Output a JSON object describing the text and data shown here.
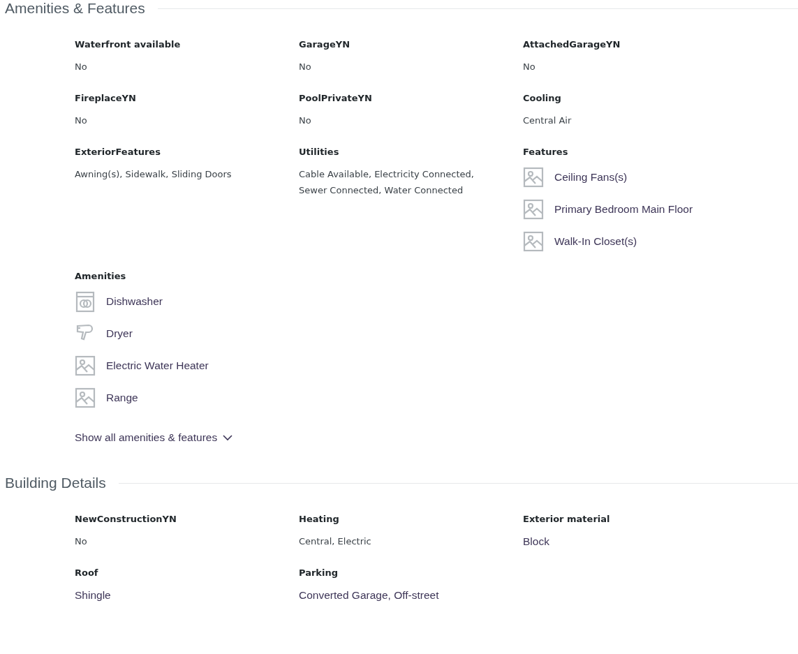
{
  "sections": [
    {
      "title": "Amenities & Features",
      "fields": [
        {
          "kind": "text",
          "label": "Waterfront available",
          "value": "No"
        },
        {
          "kind": "text",
          "label": "GarageYN",
          "value": "No"
        },
        {
          "kind": "text",
          "label": "AttachedGarageYN",
          "value": "No"
        },
        {
          "kind": "text",
          "label": "FireplaceYN",
          "value": "No"
        },
        {
          "kind": "text",
          "label": "PoolPrivateYN",
          "value": "No"
        },
        {
          "kind": "text",
          "label": "Cooling",
          "value": "Central Air"
        },
        {
          "kind": "text",
          "label": "ExteriorFeatures",
          "value": "Awning(s), Sidewalk, Sliding Doors"
        },
        {
          "kind": "text",
          "label": "Utilities",
          "value": "Cable Available, Electricity Connected, Sewer Connected, Water Connected"
        },
        {
          "kind": "list",
          "label": "Features",
          "items": [
            {
              "kind": "image",
              "text": "Ceiling Fans(s)"
            },
            {
              "kind": "image",
              "text": "Primary Bedroom Main Floor"
            },
            {
              "kind": "image",
              "text": "Walk-In Closet(s)"
            }
          ]
        },
        {
          "kind": "list",
          "label": "Amenities",
          "items": [
            {
              "kind": "dishwasher",
              "text": "Dishwasher"
            },
            {
              "kind": "dryer",
              "text": "Dryer"
            },
            {
              "kind": "image",
              "text": "Electric Water Heater"
            },
            {
              "kind": "image",
              "text": "Range"
            }
          ]
        }
      ],
      "more_link": "Show all amenities & features"
    },
    {
      "title": "Building Details",
      "fields": [
        {
          "kind": "text",
          "label": "NewConstructionYN",
          "value": "No"
        },
        {
          "kind": "text",
          "label": "Heating",
          "value": "Central, Electric"
        },
        {
          "kind": "large",
          "label": "Exterior material",
          "value": "Block"
        },
        {
          "kind": "large",
          "label": "Roof",
          "value": "Shingle"
        },
        {
          "kind": "large",
          "label": "Parking",
          "value": "Converted Garage, Off-street"
        }
      ]
    }
  ]
}
